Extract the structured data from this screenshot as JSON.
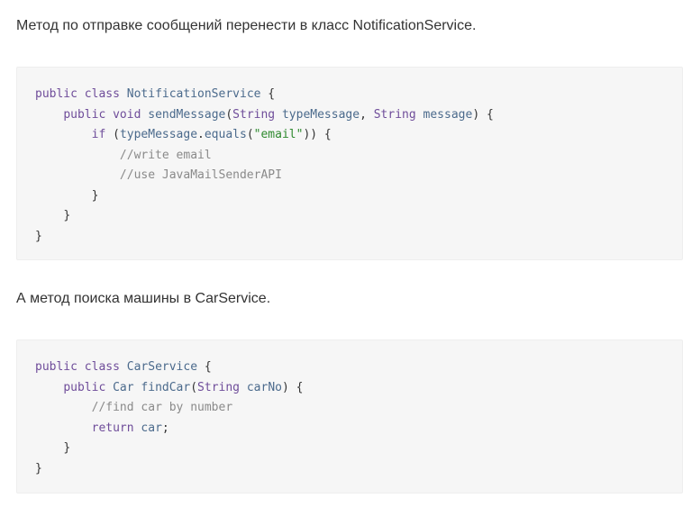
{
  "paragraphs": [
    "Метод по отправке сообщений перенести в класс NotificationService.",
    "А метод поиска машины в CarService."
  ],
  "code_blocks": [
    {
      "language": "java",
      "lines": [
        {
          "indent": 0,
          "tokens": [
            {
              "t": "kw",
              "v": "public"
            },
            {
              "t": "plain",
              "v": " "
            },
            {
              "t": "kw",
              "v": "class"
            },
            {
              "t": "plain",
              "v": " "
            },
            {
              "t": "ident",
              "v": "NotificationService"
            },
            {
              "t": "plain",
              "v": " {"
            }
          ]
        },
        {
          "indent": 1,
          "tokens": [
            {
              "t": "kw",
              "v": "public"
            },
            {
              "t": "plain",
              "v": " "
            },
            {
              "t": "kw",
              "v": "void"
            },
            {
              "t": "plain",
              "v": " "
            },
            {
              "t": "ident",
              "v": "sendMessage"
            },
            {
              "t": "plain",
              "v": "("
            },
            {
              "t": "type",
              "v": "String"
            },
            {
              "t": "plain",
              "v": " "
            },
            {
              "t": "ident",
              "v": "typeMessage"
            },
            {
              "t": "plain",
              "v": ", "
            },
            {
              "t": "type",
              "v": "String"
            },
            {
              "t": "plain",
              "v": " "
            },
            {
              "t": "ident",
              "v": "message"
            },
            {
              "t": "plain",
              "v": ") {"
            }
          ]
        },
        {
          "indent": 2,
          "tokens": [
            {
              "t": "kw",
              "v": "if"
            },
            {
              "t": "plain",
              "v": " ("
            },
            {
              "t": "ident",
              "v": "typeMessage"
            },
            {
              "t": "plain",
              "v": "."
            },
            {
              "t": "ident",
              "v": "equals"
            },
            {
              "t": "plain",
              "v": "("
            },
            {
              "t": "str",
              "v": "\"email\""
            },
            {
              "t": "plain",
              "v": ")) {"
            }
          ]
        },
        {
          "indent": 3,
          "tokens": [
            {
              "t": "comment",
              "v": "//write email"
            }
          ]
        },
        {
          "indent": 3,
          "tokens": [
            {
              "t": "comment",
              "v": "//use JavaMailSenderAPI"
            }
          ]
        },
        {
          "indent": 2,
          "tokens": [
            {
              "t": "plain",
              "v": "}"
            }
          ]
        },
        {
          "indent": 1,
          "tokens": [
            {
              "t": "plain",
              "v": "}"
            }
          ]
        },
        {
          "indent": 0,
          "tokens": [
            {
              "t": "plain",
              "v": "}"
            }
          ]
        }
      ]
    },
    {
      "language": "java",
      "lines": [
        {
          "indent": 0,
          "tokens": [
            {
              "t": "kw",
              "v": "public"
            },
            {
              "t": "plain",
              "v": " "
            },
            {
              "t": "kw",
              "v": "class"
            },
            {
              "t": "plain",
              "v": " "
            },
            {
              "t": "ident",
              "v": "CarService"
            },
            {
              "t": "plain",
              "v": " {"
            }
          ]
        },
        {
          "indent": 1,
          "tokens": [
            {
              "t": "kw",
              "v": "public"
            },
            {
              "t": "plain",
              "v": " "
            },
            {
              "t": "ident",
              "v": "Car"
            },
            {
              "t": "plain",
              "v": " "
            },
            {
              "t": "ident",
              "v": "findCar"
            },
            {
              "t": "plain",
              "v": "("
            },
            {
              "t": "type",
              "v": "String"
            },
            {
              "t": "plain",
              "v": " "
            },
            {
              "t": "ident",
              "v": "carNo"
            },
            {
              "t": "plain",
              "v": ") {"
            }
          ]
        },
        {
          "indent": 2,
          "tokens": [
            {
              "t": "comment",
              "v": "//find car by number"
            }
          ]
        },
        {
          "indent": 2,
          "tokens": [
            {
              "t": "kw",
              "v": "return"
            },
            {
              "t": "plain",
              "v": " "
            },
            {
              "t": "ident",
              "v": "car"
            },
            {
              "t": "plain",
              "v": ";"
            }
          ]
        },
        {
          "indent": 1,
          "tokens": [
            {
              "t": "plain",
              "v": "}"
            }
          ]
        },
        {
          "indent": 0,
          "tokens": [
            {
              "t": "plain",
              "v": "}"
            }
          ]
        }
      ]
    }
  ]
}
